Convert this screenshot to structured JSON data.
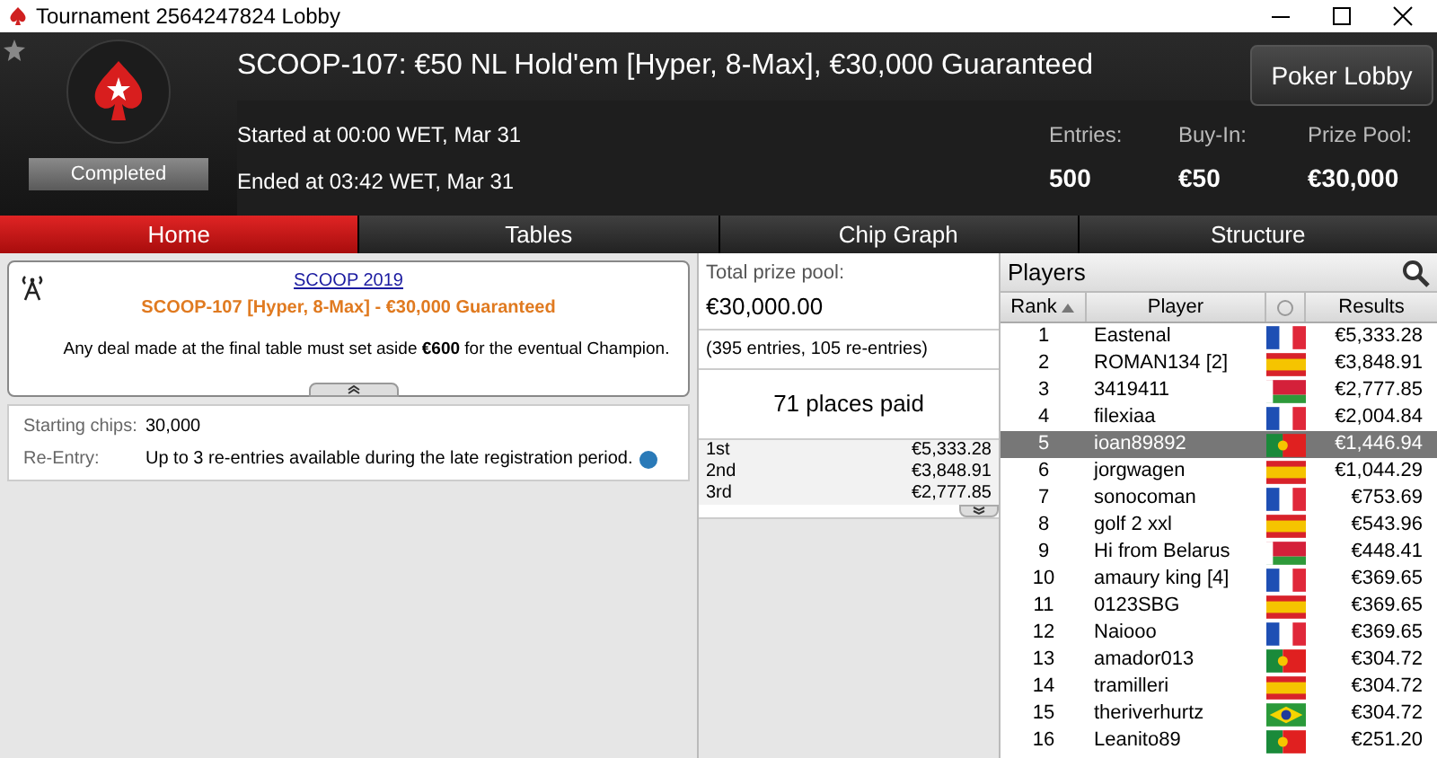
{
  "window": {
    "title": "Tournament 2564247824 Lobby"
  },
  "header": {
    "title": "SCOOP-107: €50 NL Hold'em [Hyper, 8-Max], €30,000 Guaranteed",
    "status": "Completed",
    "started": "Started at 00:00 WET, Mar 31",
    "ended": "Ended at 03:42 WET, Mar 31",
    "lobby_button": "Poker Lobby",
    "stats": [
      {
        "label": "Entries:",
        "value": "500"
      },
      {
        "label": "Buy-In:",
        "value": "€50"
      },
      {
        "label": "Prize Pool:",
        "value": "€30,000"
      }
    ]
  },
  "tabs": [
    {
      "label": "Home",
      "selected": true
    },
    {
      "label": "Tables",
      "selected": false
    },
    {
      "label": "Chip Graph",
      "selected": false
    },
    {
      "label": "Structure",
      "selected": false
    }
  ],
  "info": {
    "link": "SCOOP 2019",
    "subtitle": "SCOOP-107 [Hyper, 8-Max] - €30,000 Guaranteed",
    "notice": "Any deal made at the final table must set aside **€600** for the eventual Champion."
  },
  "details": [
    {
      "label": "Starting chips:",
      "value": "30,000"
    },
    {
      "label": "Re-Entry:",
      "value": "Up to 3 re-entries available during the late registration period."
    }
  ],
  "prizes": {
    "label": "Total prize pool:",
    "total": "€30,000.00",
    "entries": "(395 entries, 105 re-entries)",
    "paid": "71 places paid",
    "places": [
      {
        "place": "1st",
        "amount": "€5,333.28"
      },
      {
        "place": "2nd",
        "amount": "€3,848.91"
      },
      {
        "place": "3rd",
        "amount": "€2,777.85"
      }
    ]
  },
  "players": {
    "title": "Players",
    "columns": [
      "Rank",
      "Player",
      "Results"
    ],
    "rows": [
      {
        "rank": "1",
        "name": "Eastenal",
        "kind": "fr",
        "result": "€5,333.28",
        "selected": false
      },
      {
        "rank": "2",
        "name": "ROMAN134 [2]",
        "kind": "es",
        "result": "€3,848.91",
        "selected": false
      },
      {
        "rank": "3",
        "name": "3419411",
        "kind": "by",
        "result": "€2,777.85",
        "selected": false
      },
      {
        "rank": "4",
        "name": "filexiaa",
        "kind": "fr",
        "result": "€2,004.84",
        "selected": false
      },
      {
        "rank": "5",
        "name": "ioan89892",
        "kind": "pt",
        "result": "€1,446.94",
        "selected": true
      },
      {
        "rank": "6",
        "name": "jorgwagen",
        "kind": "es",
        "result": "€1,044.29",
        "selected": false
      },
      {
        "rank": "7",
        "name": "sonocoman",
        "kind": "fr",
        "result": "€753.69",
        "selected": false
      },
      {
        "rank": "8",
        "name": "golf 2 xxl",
        "kind": "es",
        "result": "€543.96",
        "selected": false
      },
      {
        "rank": "9",
        "name": "Hi from Belarus",
        "kind": "by",
        "result": "€448.41",
        "selected": false
      },
      {
        "rank": "10",
        "name": "amaury king [4]",
        "kind": "fr",
        "result": "€369.65",
        "selected": false
      },
      {
        "rank": "11",
        "name": "0123SBG",
        "kind": "es",
        "result": "€369.65",
        "selected": false
      },
      {
        "rank": "12",
        "name": "Naiooo",
        "kind": "fr",
        "result": "€369.65",
        "selected": false
      },
      {
        "rank": "13",
        "name": "amador013",
        "kind": "pt",
        "result": "€304.72",
        "selected": false
      },
      {
        "rank": "14",
        "name": "tramilleri",
        "kind": "es",
        "result": "€304.72",
        "selected": false
      },
      {
        "rank": "15",
        "name": "theriverhurtz",
        "kind": "br",
        "result": "€304.72",
        "selected": false
      },
      {
        "rank": "16",
        "name": "Leanito89",
        "kind": "pt",
        "result": "€251.20",
        "selected": false
      }
    ]
  }
}
